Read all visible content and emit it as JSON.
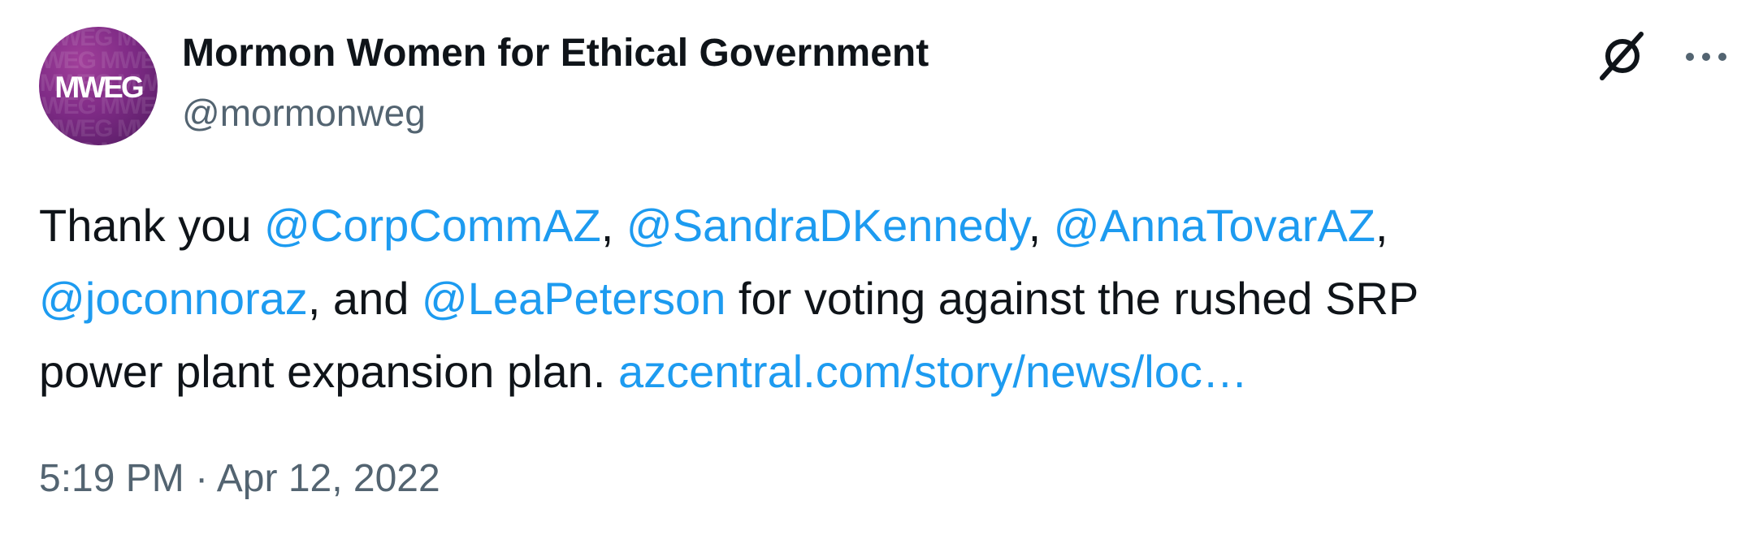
{
  "author": {
    "avatar_text": "MWEG",
    "display_name": "Mormon Women for Ethical Government",
    "handle": "@mormonweg"
  },
  "header_actions": {
    "grok_icon": "grok-icon",
    "more_icon": "more-horizontal-icon"
  },
  "tweet": {
    "line1": {
      "t1": "Thank you ",
      "m1": "@CorpCommAZ",
      "t2": ", ",
      "m2": "@SandraDKennedy",
      "t3": ", ",
      "m3": "@AnnaTovarAZ",
      "t4": ","
    },
    "line2": {
      "m4": "@joconnoraz",
      "t5": ", and ",
      "m5": "@LeaPeterson",
      "t6": " for voting against the rushed SRP"
    },
    "line3": {
      "t7": "power plant expansion plan. ",
      "link": "azcentral.com/story/news/loc…"
    }
  },
  "timestamp": {
    "time": "5:19 PM",
    "separator": " · ",
    "date": "Apr 12, 2022"
  },
  "colors": {
    "link": "#1d9bf0",
    "text": "#0f1419",
    "secondary": "#536471",
    "avatar": "#7f2b86"
  }
}
